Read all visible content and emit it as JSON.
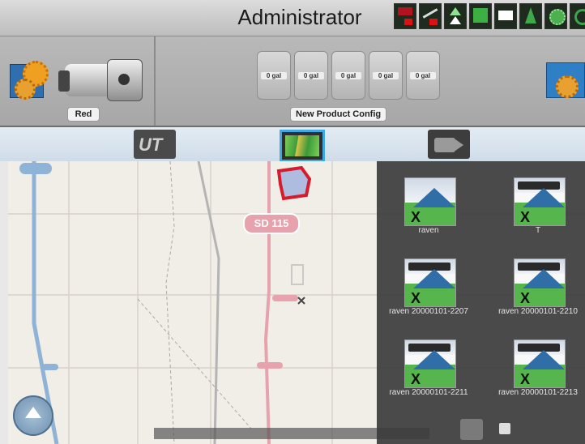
{
  "header": {
    "title": "Administrator",
    "status_icons": [
      "speed-alert-icon",
      "implement-icon",
      "guidance-arrows-icon",
      "gps-icon",
      "screen-icon",
      "map-marker-icon",
      "settings-green-icon",
      "rotate-icon"
    ]
  },
  "toolbar": {
    "machine_label": "Red",
    "product_label": "New Product Config",
    "tanks": [
      "0 gal",
      "0 gal",
      "0 gal",
      "0 gal",
      "0 gal"
    ]
  },
  "tabs": [
    {
      "name": "UT",
      "selected": false
    },
    {
      "name": "map",
      "selected": true
    },
    {
      "name": "camera",
      "selected": false
    }
  ],
  "map": {
    "road_label": "SD 115",
    "colors": {
      "road": "#e6a3ad",
      "highway": "#8fb3d6",
      "field_outline": "#d61c2c",
      "field_fill": "#aebce0"
    }
  },
  "files": [
    {
      "label": "raven",
      "icon": "file-thumbnail-icon"
    },
    {
      "label": "T",
      "icon": "file-thumbnail-icon"
    },
    {
      "label": "raven 20000101-2207",
      "icon": "file-thumbnail-icon"
    },
    {
      "label": "raven 20000101-2210",
      "icon": "file-thumbnail-icon"
    },
    {
      "label": "raven 20000101-2211",
      "icon": "file-thumbnail-icon"
    },
    {
      "label": "raven 20000101-2213",
      "icon": "file-thumbnail-icon"
    }
  ]
}
